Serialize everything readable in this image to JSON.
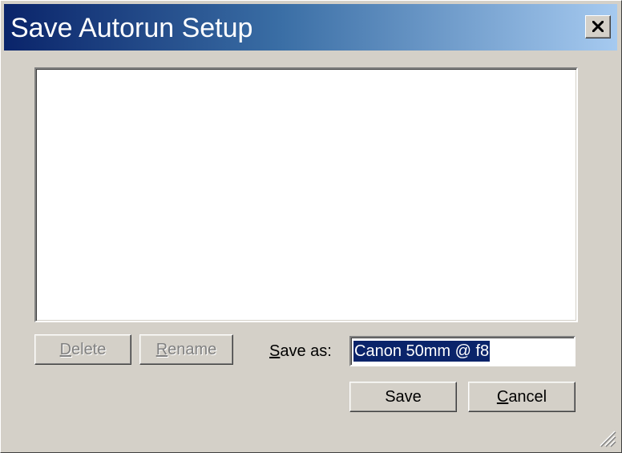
{
  "window": {
    "title": "Save Autorun Setup",
    "close_icon": "close-icon"
  },
  "presets_list": {
    "items": []
  },
  "buttons": {
    "delete": {
      "pre": "",
      "mnemonic": "D",
      "post": "elete",
      "enabled": false
    },
    "rename": {
      "pre": "",
      "mnemonic": "R",
      "post": "ename",
      "enabled": false
    },
    "save": {
      "label": "Save"
    },
    "cancel": {
      "pre": "",
      "mnemonic": "C",
      "post": "ancel"
    }
  },
  "save_as": {
    "label_mnemonic": "S",
    "label_rest": "ave as:",
    "value": "Canon 50mm @ f8",
    "selected": true
  },
  "colors": {
    "title_gradient_start": "#0a246a",
    "title_gradient_end": "#a6caf0",
    "dialog_face": "#d4d0c8",
    "selection": "#0a246a"
  }
}
